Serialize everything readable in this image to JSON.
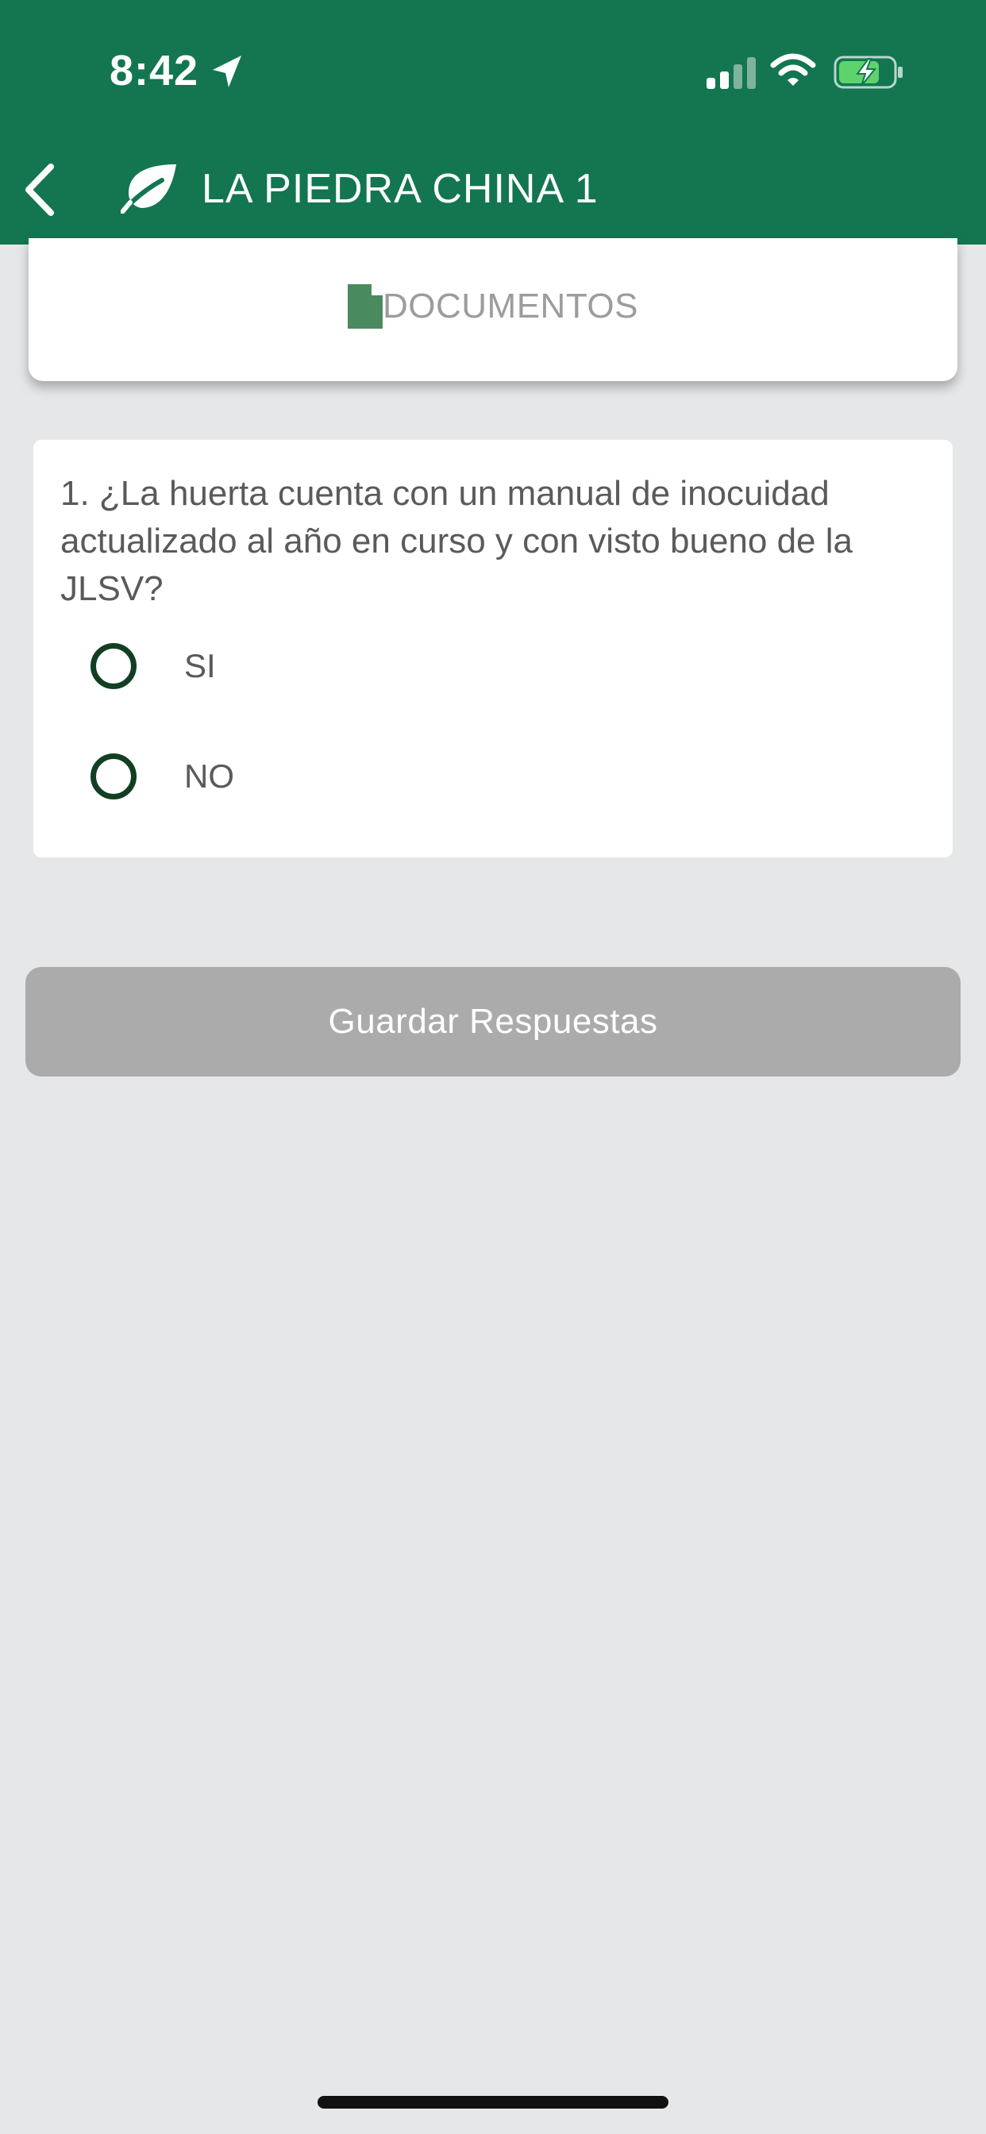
{
  "status_bar": {
    "time": "8:42"
  },
  "nav": {
    "title": "LA PIEDRA CHINA 1"
  },
  "documents": {
    "label": "DOCUMENTOS"
  },
  "question": {
    "text": "1. ¿La huerta cuenta con un manual de inocuidad actualizado al año en curso y con visto bueno de la JLSV?",
    "options": [
      "SI",
      "NO"
    ]
  },
  "save_button": {
    "label": "Guardar Respuestas"
  },
  "colors": {
    "header": "#137651",
    "background": "#e6e7e9",
    "radio_border": "#123f24",
    "button_disabled": "#ababab"
  }
}
